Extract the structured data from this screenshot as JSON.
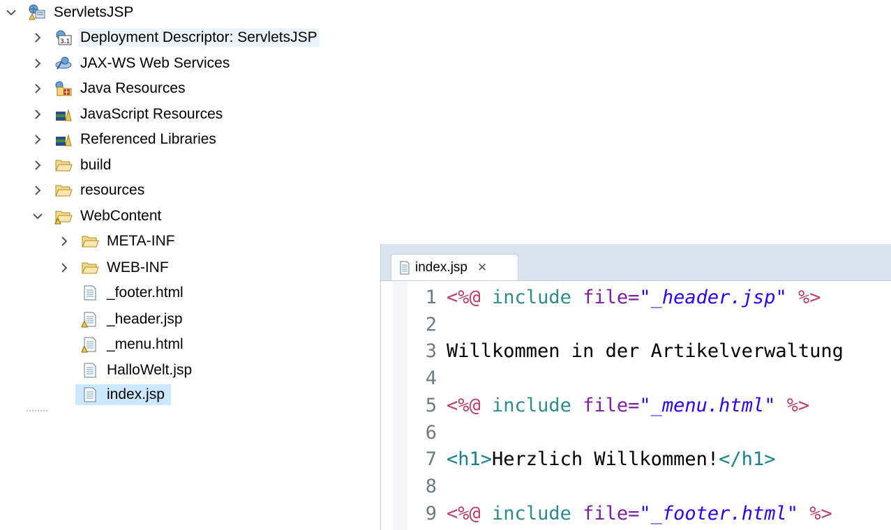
{
  "tree": {
    "project": "ServletsJSP",
    "items": [
      {
        "label": "Deployment Descriptor: ServletsJSP"
      },
      {
        "label": "JAX-WS Web Services"
      },
      {
        "label": "Java Resources"
      },
      {
        "label": "JavaScript Resources"
      },
      {
        "label": "Referenced Libraries"
      },
      {
        "label": "build"
      },
      {
        "label": "resources"
      },
      {
        "label": "WebContent"
      }
    ],
    "webcontent": [
      {
        "label": "META-INF"
      },
      {
        "label": "WEB-INF"
      },
      {
        "label": "_footer.html"
      },
      {
        "label": "_header.jsp"
      },
      {
        "label": "_menu.html"
      },
      {
        "label": "HalloWelt.jsp"
      },
      {
        "label": "index.jsp"
      }
    ]
  },
  "editor": {
    "tab": {
      "label": "index.jsp",
      "close_glyph": "✕"
    },
    "lines": [
      {
        "num": "1",
        "d1": "<%@",
        "kw": "include",
        "attr": "file=",
        "str": "\"_header.jsp\"",
        "d2": "%>"
      },
      {
        "num": "2"
      },
      {
        "num": "3",
        "text": "Willkommen in der Artikelverwaltung"
      },
      {
        "num": "4"
      },
      {
        "num": "5",
        "d1": "<%@",
        "kw": "include",
        "attr": "file=",
        "str": "\"_menu.html\"",
        "d2": "%>"
      },
      {
        "num": "6"
      },
      {
        "num": "7",
        "tag_open": "<h1>",
        "text": "Herzlich Willkommen!",
        "tag_close": "</h1>"
      },
      {
        "num": "8"
      },
      {
        "num": "9",
        "d1": "<%@",
        "kw": "include",
        "attr": "file=",
        "str": "\"_footer.html\"",
        "d2": "%>"
      }
    ]
  }
}
